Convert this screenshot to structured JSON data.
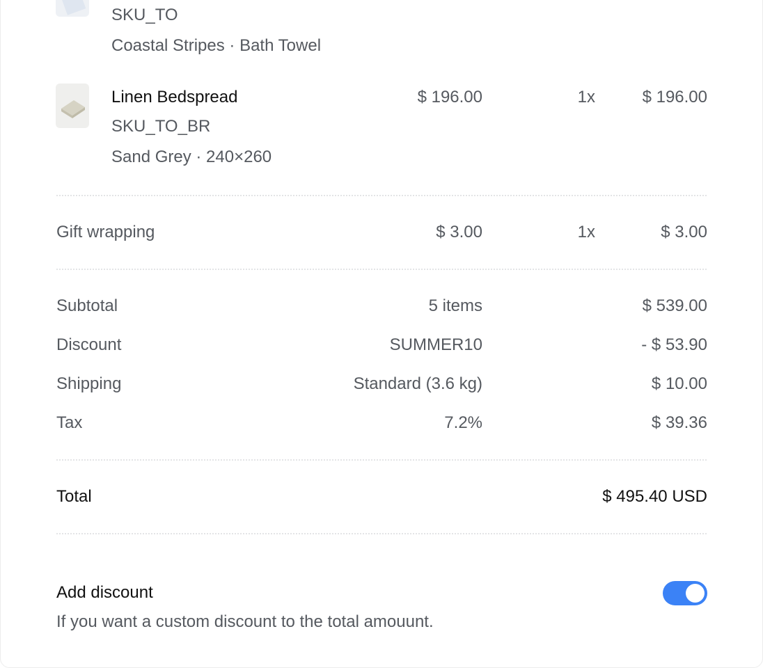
{
  "items": [
    {
      "sku": "SKU_TO",
      "variant": "Coastal Stripes · Bath Towel"
    },
    {
      "name": "Linen Bedspread",
      "sku": "SKU_TO_BR",
      "variant": "Sand Grey · 240×260",
      "price": "$ 196.00",
      "qty": "1x",
      "total": "$ 196.00"
    }
  ],
  "gift": {
    "label": "Gift wrapping",
    "price": "$ 3.00",
    "qty": "1x",
    "total": "$ 3.00"
  },
  "summary": {
    "subtotal": {
      "label": "Subtotal",
      "detail": "5 items",
      "amount": "$ 539.00"
    },
    "discount": {
      "label": "Discount",
      "detail": "SUMMER10",
      "amount": "- $ 53.90"
    },
    "shipping": {
      "label": "Shipping",
      "detail": "Standard (3.6 kg)",
      "amount": "$ 10.00"
    },
    "tax": {
      "label": "Tax",
      "detail": "7.2%",
      "amount": "$ 39.36"
    }
  },
  "total": {
    "label": "Total",
    "amount": "$ 495.40 USD"
  },
  "add_discount": {
    "title": "Add discount",
    "description": "If you want a custom discount to the total amouunt.",
    "enabled": true
  },
  "colors": {
    "accent": "#3b82f6",
    "muted_text": "#55595f",
    "divider": "#e3e4e6"
  }
}
